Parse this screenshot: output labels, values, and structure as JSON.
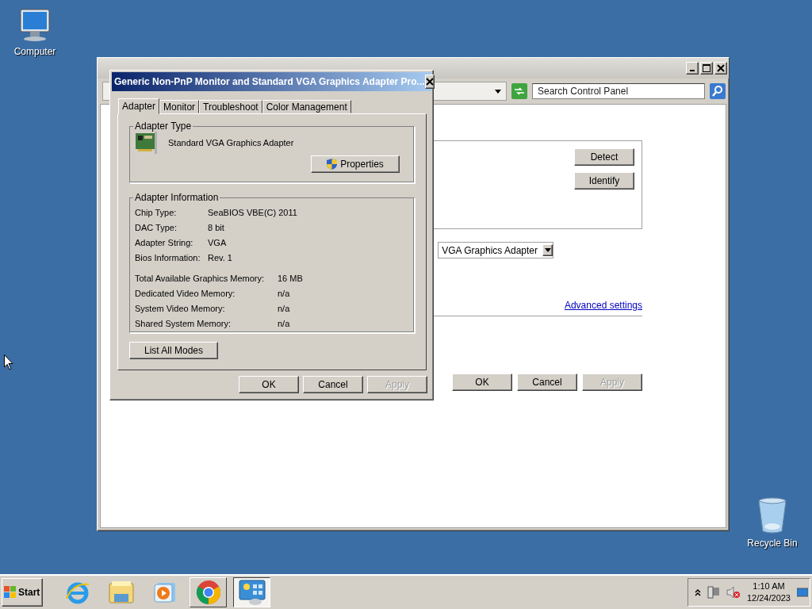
{
  "desktop_icons": [
    {
      "label": "Computer",
      "kind": "computer"
    },
    {
      "label": "Recycle Bin",
      "kind": "recycle"
    }
  ],
  "back_window": {
    "search": {
      "placeholder": "Search Control Panel"
    },
    "side_buttons": [
      "Detect",
      "Identify"
    ],
    "adapter_dropdown": {
      "value": "VGA Graphics Adapter"
    },
    "advanced_link": "Advanced settings",
    "buttons": [
      {
        "label": "OK",
        "disabled": false
      },
      {
        "label": "Cancel",
        "disabled": false
      },
      {
        "label": "Apply",
        "disabled": true
      }
    ]
  },
  "dialog": {
    "title": "Generic Non-PnP Monitor and Standard VGA Graphics Adapter Pro...",
    "tabs": [
      {
        "label": "Adapter",
        "selected": true
      },
      {
        "label": "Monitor",
        "selected": false
      },
      {
        "label": "Troubleshoot",
        "selected": false
      },
      {
        "label": "Color Management",
        "selected": false
      }
    ],
    "adapter_type": {
      "legend": "Adapter Type",
      "name": "Standard VGA Graphics Adapter",
      "button": "Properties"
    },
    "adapter_information": {
      "legend": "Adapter Information",
      "rows": [
        {
          "label": "Chip Type:",
          "value": "SeaBIOS VBE(C) 2011"
        },
        {
          "label": "DAC Type:",
          "value": "8 bit"
        },
        {
          "label": "Adapter String:",
          "value": "VGA"
        },
        {
          "label": "Bios Information:",
          "value": "Rev. 1"
        }
      ],
      "memory_rows": [
        {
          "label": "Total Available Graphics Memory:",
          "value": "16 MB"
        },
        {
          "label": "Dedicated Video Memory:",
          "value": "n/a"
        },
        {
          "label": "System Video Memory:",
          "value": "n/a"
        },
        {
          "label": "Shared System Memory:",
          "value": "n/a"
        }
      ]
    },
    "list_modes_button": "List All Modes",
    "buttons": [
      {
        "label": "OK",
        "disabled": false
      },
      {
        "label": "Cancel",
        "disabled": false
      },
      {
        "label": "Apply",
        "disabled": true
      }
    ]
  },
  "taskbar": {
    "start": "Start",
    "apps": [
      {
        "kind": "ie",
        "running": false,
        "selected": false
      },
      {
        "kind": "explorer",
        "running": false,
        "selected": false
      },
      {
        "kind": "media",
        "running": false,
        "selected": false
      },
      {
        "kind": "chrome",
        "running": true,
        "selected": false
      },
      {
        "kind": "control",
        "running": true,
        "selected": true
      }
    ],
    "clock": {
      "time": "1:10 AM",
      "date": "12/24/2023"
    }
  }
}
